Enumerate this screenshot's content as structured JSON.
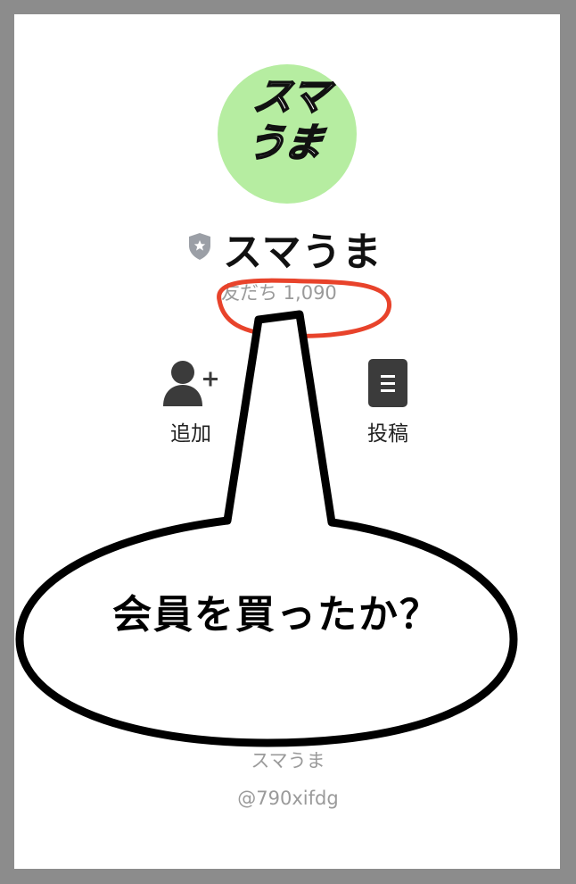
{
  "profile": {
    "avatar_text_line1": "スマ",
    "avatar_text_line2": "うま",
    "name": "スマうま",
    "friends_label": "友だち 1,090"
  },
  "actions": {
    "add_label": "追加",
    "post_label": "投稿"
  },
  "annotation": {
    "callout_text": "会員を買ったか？",
    "highlight_color": "#e8432b"
  },
  "footer": {
    "name": "スマうま",
    "account_id": "@790xifdg"
  },
  "colors": {
    "avatar_bg": "#b6eda1",
    "frame": "#8c8c8c"
  },
  "icons": {
    "badge": "shield-star-icon",
    "add": "add-friend-icon",
    "post": "post-icon"
  }
}
